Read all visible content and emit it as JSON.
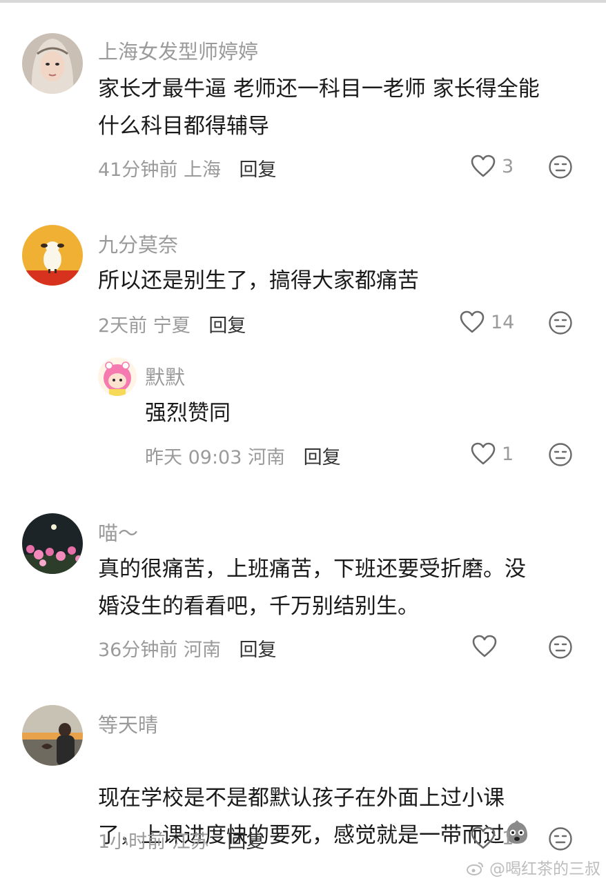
{
  "comments": [
    {
      "username": "上海女发型师婷婷",
      "text": "家长才最牛逼 老师还一科目一老师 家长得全能\n什么科目都得辅导",
      "time": "41分钟前",
      "location": "上海",
      "reply_label": "回复",
      "likes": "3"
    },
    {
      "username": "九分莫奈",
      "text": "所以还是别生了，搞得大家都痛苦",
      "time": "2天前",
      "location": "宁夏",
      "reply_label": "回复",
      "likes": "14"
    },
    {
      "username": "默默",
      "text": "强烈赞同",
      "time": "昨天 09:03",
      "location": "河南",
      "reply_label": "回复",
      "likes": "1"
    },
    {
      "username": "喵～",
      "text": "真的很痛苦，上班痛苦，下班还要受折磨。没\n婚没生的看看吧，千万别结别生。",
      "time": "36分钟前",
      "location": "河南",
      "reply_label": "回复",
      "likes": ""
    },
    {
      "username": "等天晴",
      "text": "现在学校是不是都默认孩子在外面上过小课\n了，上课进度快的要死，感觉就是一带而过",
      "time": "1小时前",
      "location": "江苏",
      "reply_label": "回复",
      "likes": "1"
    }
  ],
  "watermark": "@喝红茶的三叔"
}
